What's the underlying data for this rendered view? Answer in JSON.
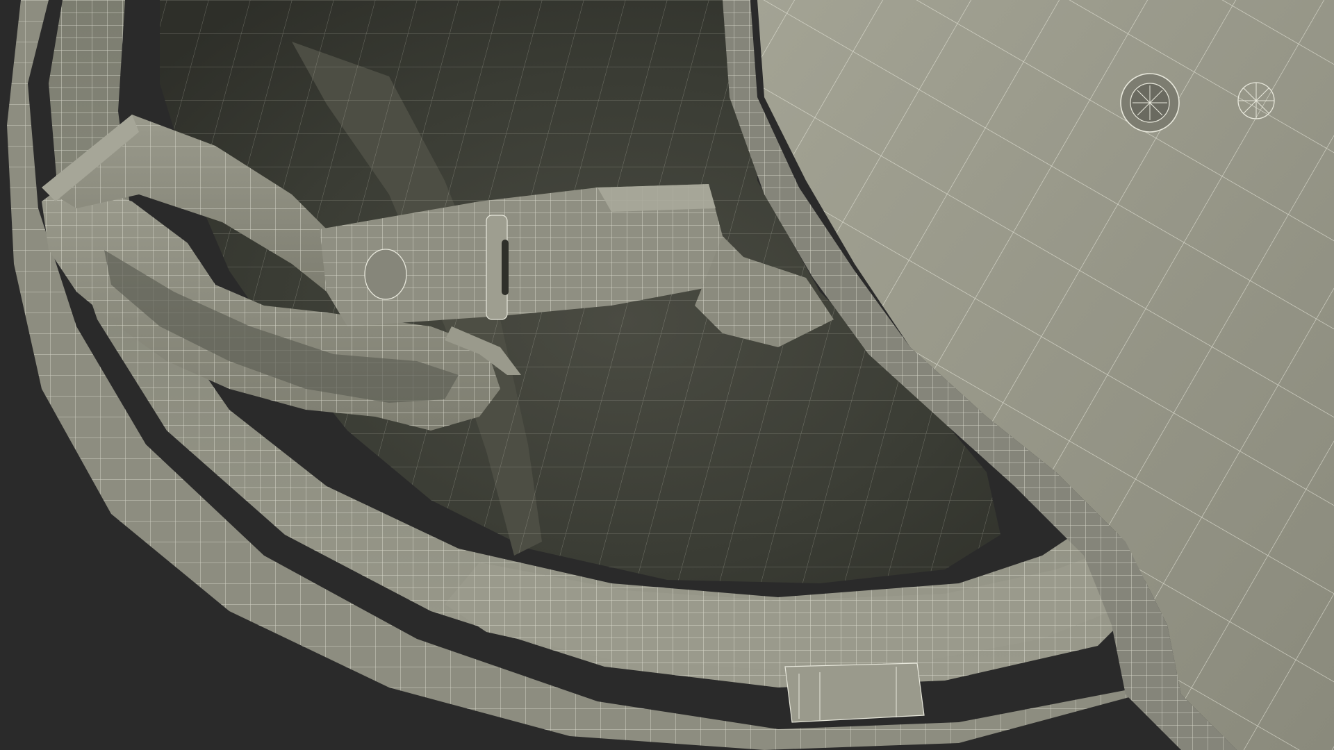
{
  "scene": {
    "subject": "helmet-interior-wireframe",
    "colors": {
      "background": "#2a2a2a",
      "interior_dark": "#3a3c34",
      "surface": "#8a8a7c",
      "surface_light": "#9e9e90",
      "surface_shadow": "#5e5f55",
      "wire": "#e8e8dc"
    }
  }
}
